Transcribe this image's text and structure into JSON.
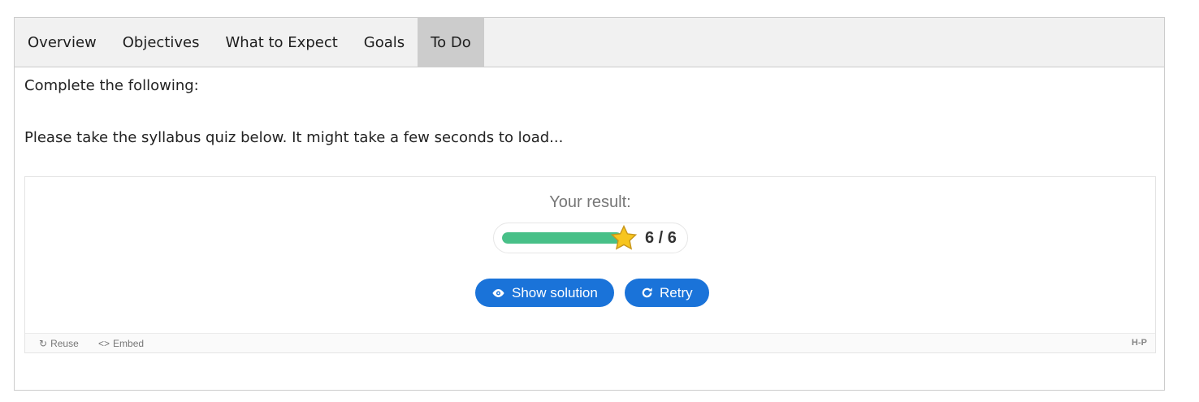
{
  "tabs": [
    {
      "label": "Overview"
    },
    {
      "label": "Objectives"
    },
    {
      "label": "What to Expect"
    },
    {
      "label": "Goals"
    },
    {
      "label": "To Do"
    }
  ],
  "active_tab": "To Do",
  "content": {
    "intro": "Complete the following:",
    "instruction": "Please take the syllabus quiz below. It might take a few seconds to load..."
  },
  "quiz": {
    "result_label": "Your result:",
    "score": 6,
    "max_score": 6,
    "score_text": "6 / 6",
    "progress_fraction": 1.0,
    "buttons": {
      "show_solution": "Show solution",
      "retry": "Retry"
    },
    "footer": {
      "reuse": "Reuse",
      "embed": "Embed",
      "logo": "H-P"
    }
  },
  "colors": {
    "tab_bar": "#f1f1f1",
    "active_tab": "#cccccc",
    "progress": "#48c088",
    "button": "#1a73d9",
    "star": "#f7c51e"
  }
}
